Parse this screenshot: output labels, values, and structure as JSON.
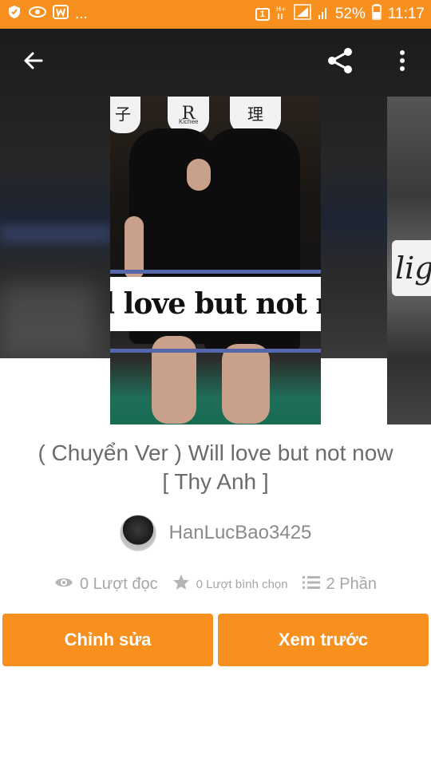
{
  "status_bar": {
    "left_text": "...",
    "battery": "52%",
    "time": "11:17",
    "icons": [
      "shield-icon",
      "eye-icon",
      "wattpad-icon",
      "sim-icon",
      "network-icon",
      "signal-icon",
      "battery-icon"
    ]
  },
  "toolbar": {
    "back_icon": "arrow-left-icon",
    "share_icon": "share-icon",
    "more_icon": "more-vertical-icon"
  },
  "cover": {
    "title_text": "Will love but not now",
    "lantern_chars": [
      "子",
      "R",
      "理"
    ],
    "lantern_small_label": "Kichee"
  },
  "next_cover": {
    "partial_text": "lig"
  },
  "story": {
    "title_line1": "( Chuyển Ver ) Will love but not now",
    "title_line2": "[ Thy Anh ]",
    "author": "HanLucBao3425"
  },
  "stats": {
    "reads": "0 Lượt đọc",
    "votes": "0 Lượt bình chọn",
    "parts": "2 Phần"
  },
  "actions": {
    "edit_label": "Chỉnh sửa",
    "preview_label": "Xem trước"
  },
  "colors": {
    "accent": "#f7901e",
    "muted_text": "#6b6b6b",
    "stat_text": "#a6a6a6"
  }
}
